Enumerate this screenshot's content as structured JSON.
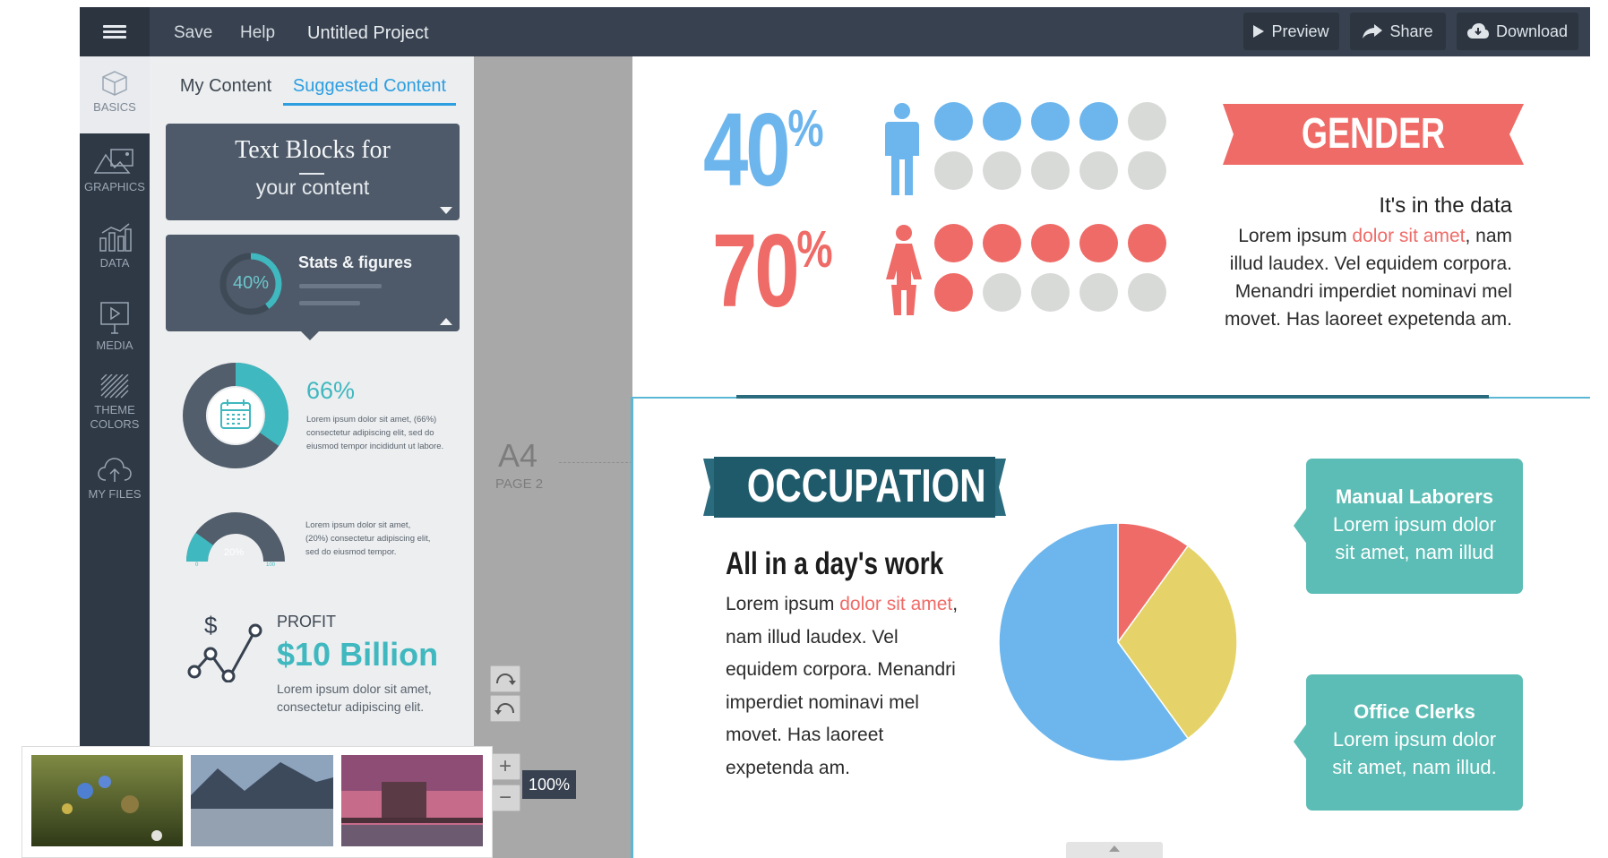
{
  "topbar": {
    "save": "Save",
    "help": "Help",
    "project_title": "Untitled Project",
    "preview": "Preview",
    "share": "Share",
    "download": "Download"
  },
  "rail": {
    "basics": "BASICS",
    "graphics": "GRAPHICS",
    "data": "DATA",
    "media": "MEDIA",
    "theme_colors_1": "THEME",
    "theme_colors_2": "COLORS",
    "my_files": "MY FILES"
  },
  "panel": {
    "tab_my": "My Content",
    "tab_suggested": "Suggested Content",
    "text_blocks_title": "Text Blocks for",
    "text_blocks_sub": "your content",
    "stats_title": "Stats & figures",
    "stats_ring_value": "40%",
    "donut_pct": "66%",
    "donut_desc_1": "Lorem ipsum dolor sit amet, (66%)",
    "donut_desc_2": "consectetur adipiscing elit, sed do",
    "donut_desc_3": "eiusmod tempor incididunt ut labore.",
    "gauge_value": "20%",
    "gauge_min": "0",
    "gauge_max": "100",
    "gauge_desc_1": "Lorem ipsum dolor sit amet,",
    "gauge_desc_2": "(20%) consectetur adipiscing elit,",
    "gauge_desc_3": "sed do eiusmod tempor.",
    "profit_symbol": "$",
    "profit_label": "PROFIT",
    "profit_value": "$10 Billion",
    "profit_desc_1": "Lorem ipsum dolor sit amet,",
    "profit_desc_2": "consectetur adipiscing elit."
  },
  "workspace": {
    "paper_size": "A4",
    "page_label": "PAGE 2",
    "zoom": "100%"
  },
  "page1": {
    "pct_male": "40",
    "pct_female": "70",
    "pct_sign": "%",
    "male_filled": 4,
    "female_filled": 6,
    "dots_total": 10,
    "gender_title": "GENDER",
    "data_heading": "It's in the data",
    "body_a": "Lorem ipsum ",
    "body_red": "dolor sit amet",
    "body_b": ", nam illud laudex. Vel equidem corpora. Menandri imperdiet nominavi mel movet. Has laoreet expetenda am."
  },
  "page2": {
    "occ_title": "OCCUPATION",
    "occ_heading": "All in a day's work",
    "body_a": "Lorem ipsum ",
    "body_red": "dolor sit amet",
    "body_b": ", nam illud laudex. Vel equidem corpora. Menandri imperdiet nominavi mel movet. Has laoreet expetenda am.",
    "callout1_title": "Manual Laborers",
    "callout1_text": "Lorem ipsum dolor sit amet, nam illud",
    "callout2_title": "Office Clerks",
    "callout2_text": "Lorem ipsum dolor sit amet, nam illud."
  },
  "chart_data": {
    "type": "pie",
    "values": [
      10,
      30,
      60
    ],
    "colors": [
      "#ef6b67",
      "#e5d36a",
      "#6cb6ed"
    ]
  },
  "colors": {
    "accent_blue": "#2d9ee0",
    "teal": "#3fb8bf",
    "red": "#ef6b67",
    "dark": "#37414f"
  }
}
